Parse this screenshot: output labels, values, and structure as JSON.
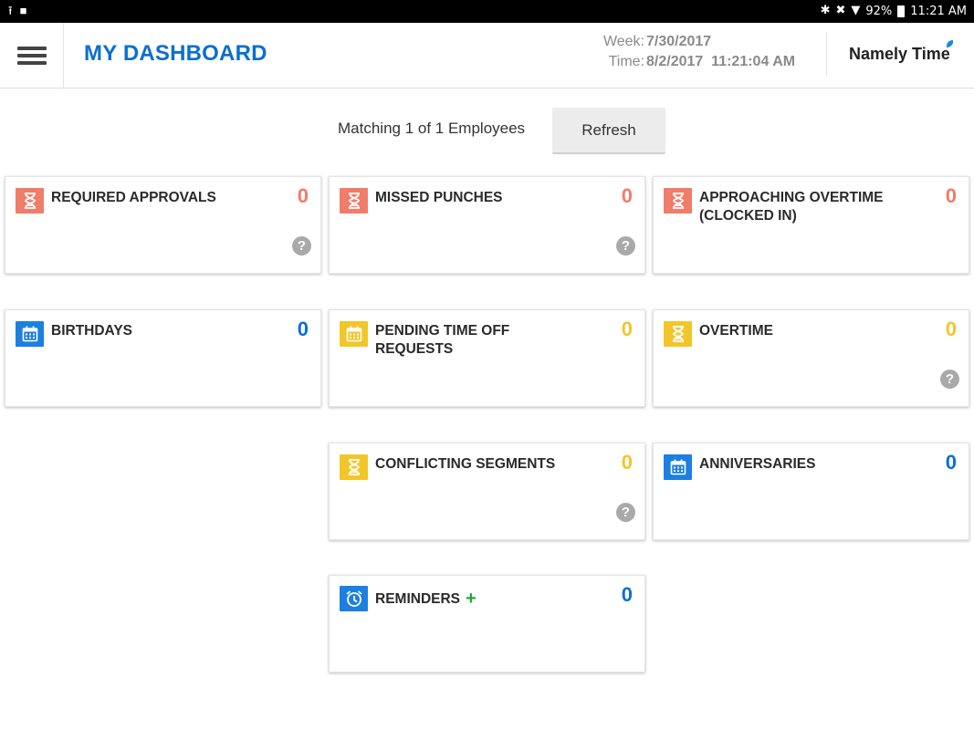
{
  "status_bar": {
    "battery": "92%",
    "time": "11:21 AM"
  },
  "header": {
    "title": "MY DASHBOARD",
    "week_label": "Week:",
    "week_value": "7/30/2017",
    "time_label": "Time:",
    "time_value": "8/2/2017  11:21:04 AM",
    "brand": "Namely Time"
  },
  "filter": {
    "matching_text": "Matching 1 of 1 Employees",
    "refresh_label": "Refresh"
  },
  "cards": {
    "required_approvals": {
      "label": "REQUIRED APPROVALS",
      "count": "0",
      "icon": "hourglass-icon",
      "color": "#f07c6a",
      "help": "?"
    },
    "missed_punches": {
      "label": "MISSED PUNCHES",
      "count": "0",
      "icon": "hourglass-icon",
      "color": "#f07c6a",
      "help": "?"
    },
    "approaching_overtime": {
      "label": "APPROACHING OVERTIME (CLOCKED IN)",
      "count": "0",
      "icon": "hourglass-icon",
      "color": "#f07c6a"
    },
    "birthdays": {
      "label": "BIRTHDAYS",
      "count": "0",
      "icon": "calendar-icon",
      "color": "#1d7fe0"
    },
    "pending_time_off": {
      "label": "PENDING TIME OFF REQUESTS",
      "count": "0",
      "icon": "calendar-icon",
      "color": "#f2c62a"
    },
    "overtime": {
      "label": "OVERTIME",
      "count": "0",
      "icon": "hourglass-icon",
      "color": "#f2c62a",
      "help": "?"
    },
    "conflicting_segments": {
      "label": "CONFLICTING SEGMENTS",
      "count": "0",
      "icon": "hourglass-icon",
      "color": "#f2c62a",
      "help": "?"
    },
    "anniversaries": {
      "label": "ANNIVERSARIES",
      "count": "0",
      "icon": "calendar-icon",
      "color": "#1d7fe0"
    },
    "reminders": {
      "label": "REMINDERS",
      "add": "+",
      "count": "0",
      "icon": "alarm-clock-icon",
      "color": "#1d7fe0"
    }
  }
}
